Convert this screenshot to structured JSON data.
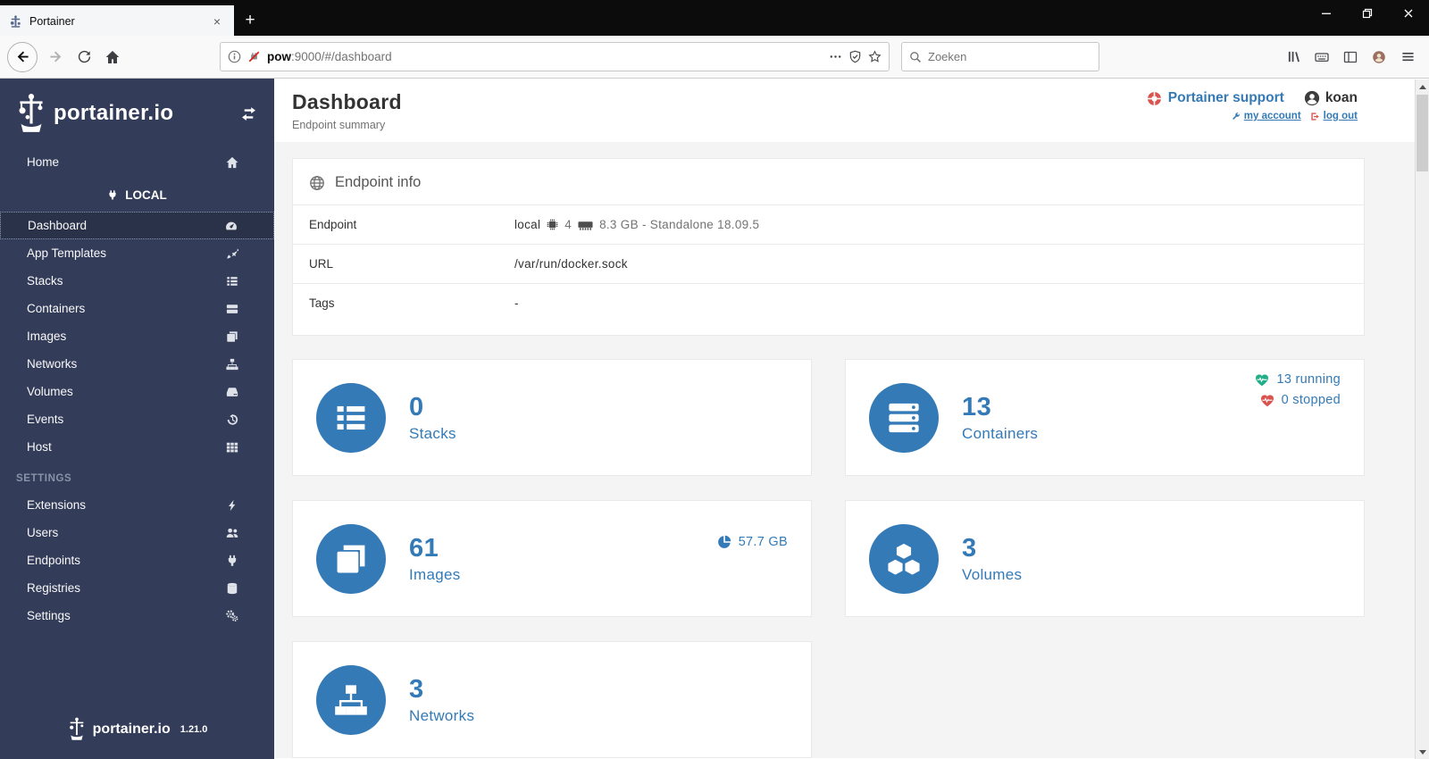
{
  "theme": {
    "accent": "#337ab7",
    "sidebar-bg": "#333c59",
    "sidebar-active-bg": "#2a3249",
    "content-bg": "#f4f4f4",
    "running-green": "#23ae89",
    "stopped-red": "#d9534f",
    "support-red": "#d9534f"
  },
  "browser": {
    "tab_title": "Portainer",
    "new_tab": "+",
    "url_host": "pow",
    "url_rest": ":9000/#/dashboard",
    "search_placeholder": "Zoeken"
  },
  "sidebar": {
    "logo": "portainer.io",
    "local_section": "LOCAL",
    "settings_section": "SETTINGS",
    "items": [
      {
        "label": "Home"
      },
      {
        "label": "Dashboard"
      },
      {
        "label": "App Templates"
      },
      {
        "label": "Stacks"
      },
      {
        "label": "Containers"
      },
      {
        "label": "Images"
      },
      {
        "label": "Networks"
      },
      {
        "label": "Volumes"
      },
      {
        "label": "Events"
      },
      {
        "label": "Host"
      },
      {
        "label": "Extensions"
      },
      {
        "label": "Users"
      },
      {
        "label": "Endpoints"
      },
      {
        "label": "Registries"
      },
      {
        "label": "Settings"
      }
    ],
    "footer_logo": "portainer.io",
    "version": "1.21.0"
  },
  "header": {
    "title": "Dashboard",
    "subtitle": "Endpoint summary",
    "support": "Portainer support",
    "username": "koan",
    "my_account": "my account",
    "log_out": "log out"
  },
  "endpoint_info": {
    "title": "Endpoint info",
    "rows": {
      "endpoint_label": "Endpoint",
      "endpoint_name": "local",
      "cpu_count": "4",
      "memory_and_version": "8.3 GB - Standalone 18.09.5",
      "url_label": "URL",
      "url_value": "/var/run/docker.sock",
      "tags_label": "Tags",
      "tags_value": "-"
    }
  },
  "widgets": {
    "stacks": {
      "count": "0",
      "label": "Stacks"
    },
    "containers": {
      "count": "13",
      "label": "Containers",
      "running": "13 running",
      "stopped": "0 stopped"
    },
    "images": {
      "count": "61",
      "label": "Images",
      "size": "57.7 GB"
    },
    "volumes": {
      "count": "3",
      "label": "Volumes"
    },
    "networks": {
      "count": "3",
      "label": "Networks"
    }
  }
}
